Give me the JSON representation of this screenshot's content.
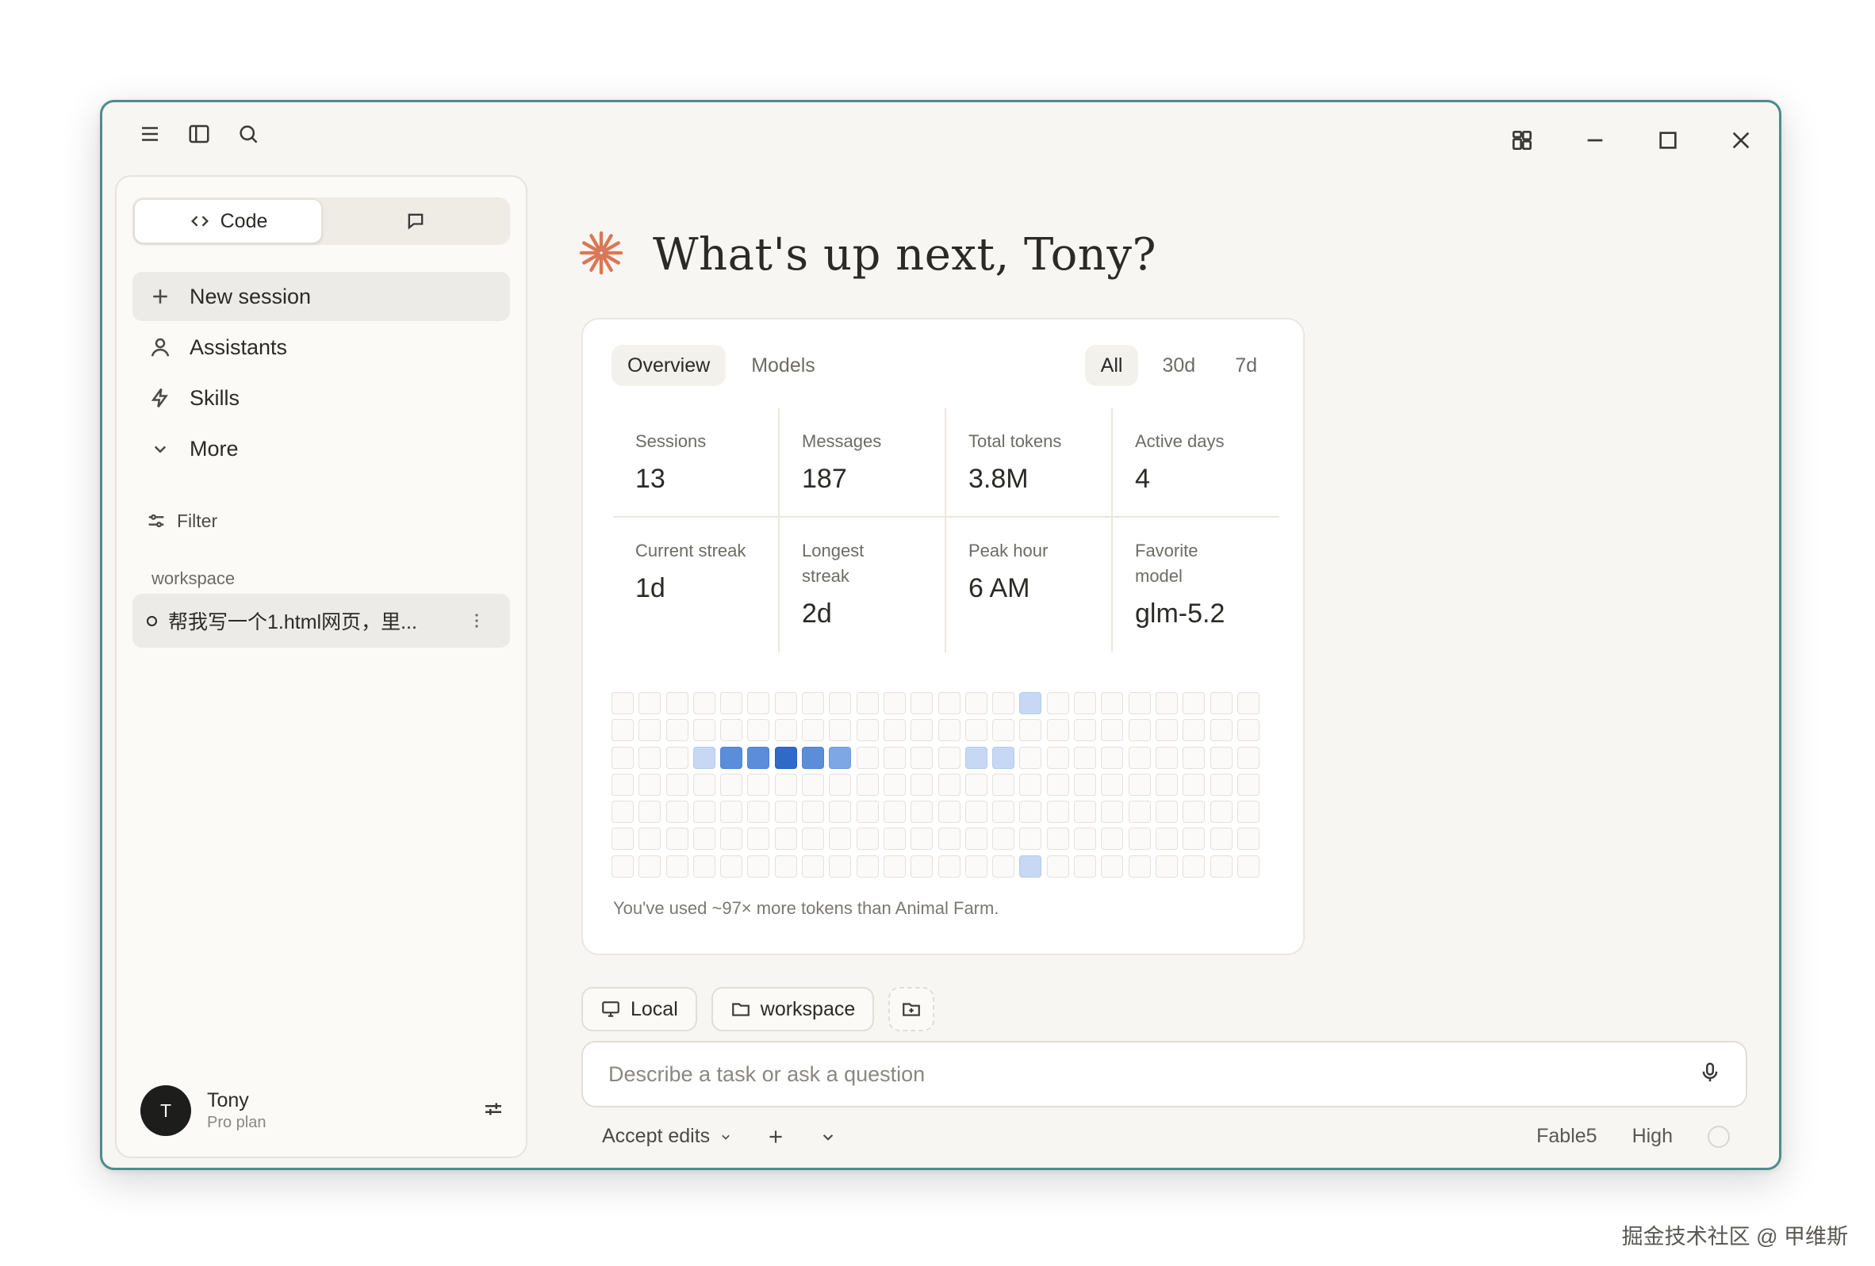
{
  "sidebar": {
    "mode_code_label": "Code",
    "nav": [
      {
        "label": "New session",
        "icon": "plus-icon"
      },
      {
        "label": "Assistants",
        "icon": "user-icon"
      },
      {
        "label": "Skills",
        "icon": "lightning-icon"
      },
      {
        "label": "More",
        "icon": "chevron-down-icon"
      }
    ],
    "filter_label": "Filter",
    "workspace_label": "workspace",
    "session_title": "帮我写一个1.html网页，里...",
    "user": {
      "avatar_initial": "T",
      "name": "Tony",
      "plan": "Pro plan"
    }
  },
  "main": {
    "greeting": "What's up next, Tony?",
    "accent_color": "#d97757",
    "stats": {
      "tabs": [
        "Overview",
        "Models"
      ],
      "ranges": [
        "All",
        "30d",
        "7d"
      ],
      "metrics": [
        {
          "label": "Sessions",
          "value": "13"
        },
        {
          "label": "Messages",
          "value": "187"
        },
        {
          "label": "Total tokens",
          "value": "3.8M"
        },
        {
          "label": "Active days",
          "value": "4"
        },
        {
          "label": "Current streak",
          "value": "1d"
        },
        {
          "label": "Longest streak",
          "value": "2d"
        },
        {
          "label": "Peak hour",
          "value": "6 AM"
        },
        {
          "label": "Favorite model",
          "value": "glm-5.2"
        }
      ],
      "activity_grid": [
        [
          0,
          0,
          0,
          0,
          0,
          0,
          0,
          0,
          0,
          0,
          0,
          0,
          0,
          0,
          0,
          1,
          0,
          0,
          0,
          0,
          0,
          0,
          0,
          0
        ],
        [
          0,
          0,
          0,
          0,
          0,
          0,
          0,
          0,
          0,
          0,
          0,
          0,
          0,
          0,
          0,
          0,
          0,
          0,
          0,
          0,
          0,
          0,
          0,
          0
        ],
        [
          0,
          0,
          0,
          1,
          3,
          3,
          4,
          3,
          2,
          0,
          0,
          0,
          0,
          1,
          1,
          0,
          0,
          0,
          0,
          0,
          0,
          0,
          0,
          0
        ],
        [
          0,
          0,
          0,
          0,
          0,
          0,
          0,
          0,
          0,
          0,
          0,
          0,
          0,
          0,
          0,
          0,
          0,
          0,
          0,
          0,
          0,
          0,
          0,
          0
        ],
        [
          0,
          0,
          0,
          0,
          0,
          0,
          0,
          0,
          0,
          0,
          0,
          0,
          0,
          0,
          0,
          0,
          0,
          0,
          0,
          0,
          0,
          0,
          0,
          0
        ],
        [
          0,
          0,
          0,
          0,
          0,
          0,
          0,
          0,
          0,
          0,
          0,
          0,
          0,
          0,
          0,
          0,
          0,
          0,
          0,
          0,
          0,
          0,
          0,
          0
        ],
        [
          0,
          0,
          0,
          0,
          0,
          0,
          0,
          0,
          0,
          0,
          0,
          0,
          0,
          0,
          0,
          1,
          0,
          0,
          0,
          0,
          0,
          0,
          0,
          0
        ]
      ],
      "note": "You've used ~97× more tokens than Animal Farm."
    },
    "context": {
      "local_label": "Local",
      "workspace_label": "workspace"
    },
    "prompt": {
      "placeholder": "Describe a task or ask a question"
    },
    "footer": {
      "mode_label": "Accept edits",
      "model_label": "Fable5",
      "effort_label": "High"
    }
  },
  "watermark": "掘金技术社区 @ 甲维斯"
}
